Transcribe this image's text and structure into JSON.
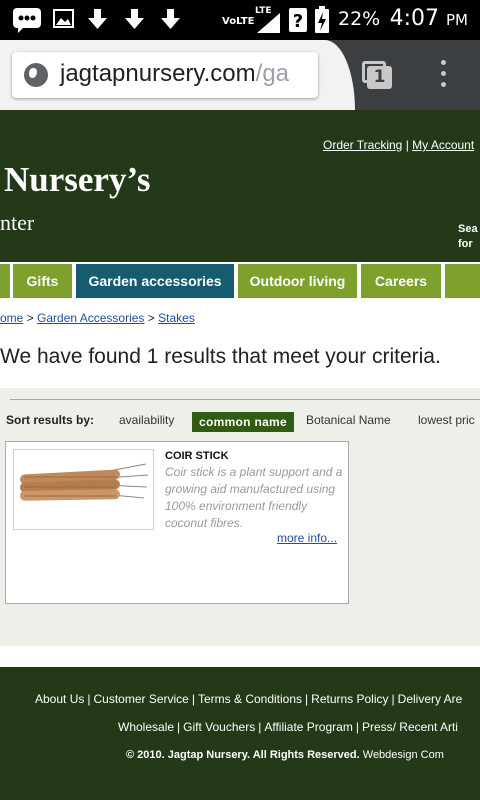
{
  "status_bar": {
    "network": "VoLTE",
    "lte": "LTE",
    "battery": "22%",
    "time": "4:07",
    "ampm": "PM"
  },
  "browser": {
    "url_main": "jagtapnursery.com",
    "url_rest": "/ga",
    "tab_count": "1"
  },
  "header": {
    "links": [
      "Order Tracking",
      "My Account"
    ],
    "brand_title": "Nursery’s",
    "brand_sub": "nter",
    "search_line1": "Sea",
    "search_line2": "for"
  },
  "nav": {
    "items": [
      "Gifts",
      "Garden accessories",
      "Outdoor living",
      "Careers"
    ]
  },
  "breadcrumb": {
    "items": [
      "Home",
      "Garden Accessories",
      "Stakes"
    ],
    "separator": ">",
    "first_visible": "ome"
  },
  "results_heading": "We have found 1 results that meet your criteria.",
  "sort": {
    "label": "Sort results by:",
    "options": [
      "availability",
      "common name",
      "Botanical Name",
      "lowest pric"
    ],
    "active": "common name"
  },
  "product": {
    "name": "COIR STICK",
    "description": "Coir stick is a plant support and a growing aid manufactured using 100% environment friendly coconut fibres.",
    "more": "more info..."
  },
  "footer": {
    "row1": [
      "About Us",
      "Customer Service",
      "Terms & Conditions",
      "Returns Policy",
      "Delivery Are"
    ],
    "row2": [
      "Wholesale",
      "Gift Vouchers",
      "Affiliate Program",
      "Press/ Recent Arti"
    ],
    "copyright_bold": "© 2010. Jagtap Nursery. All Rights Reserved.",
    "copyright_rest": " Webdesign Com"
  },
  "colors": {
    "header_bg": "#233918",
    "nav_green": "#7ea02d",
    "nav_active": "#155c70",
    "sort_active": "#2f5c10",
    "link": "#1c4f9c"
  }
}
